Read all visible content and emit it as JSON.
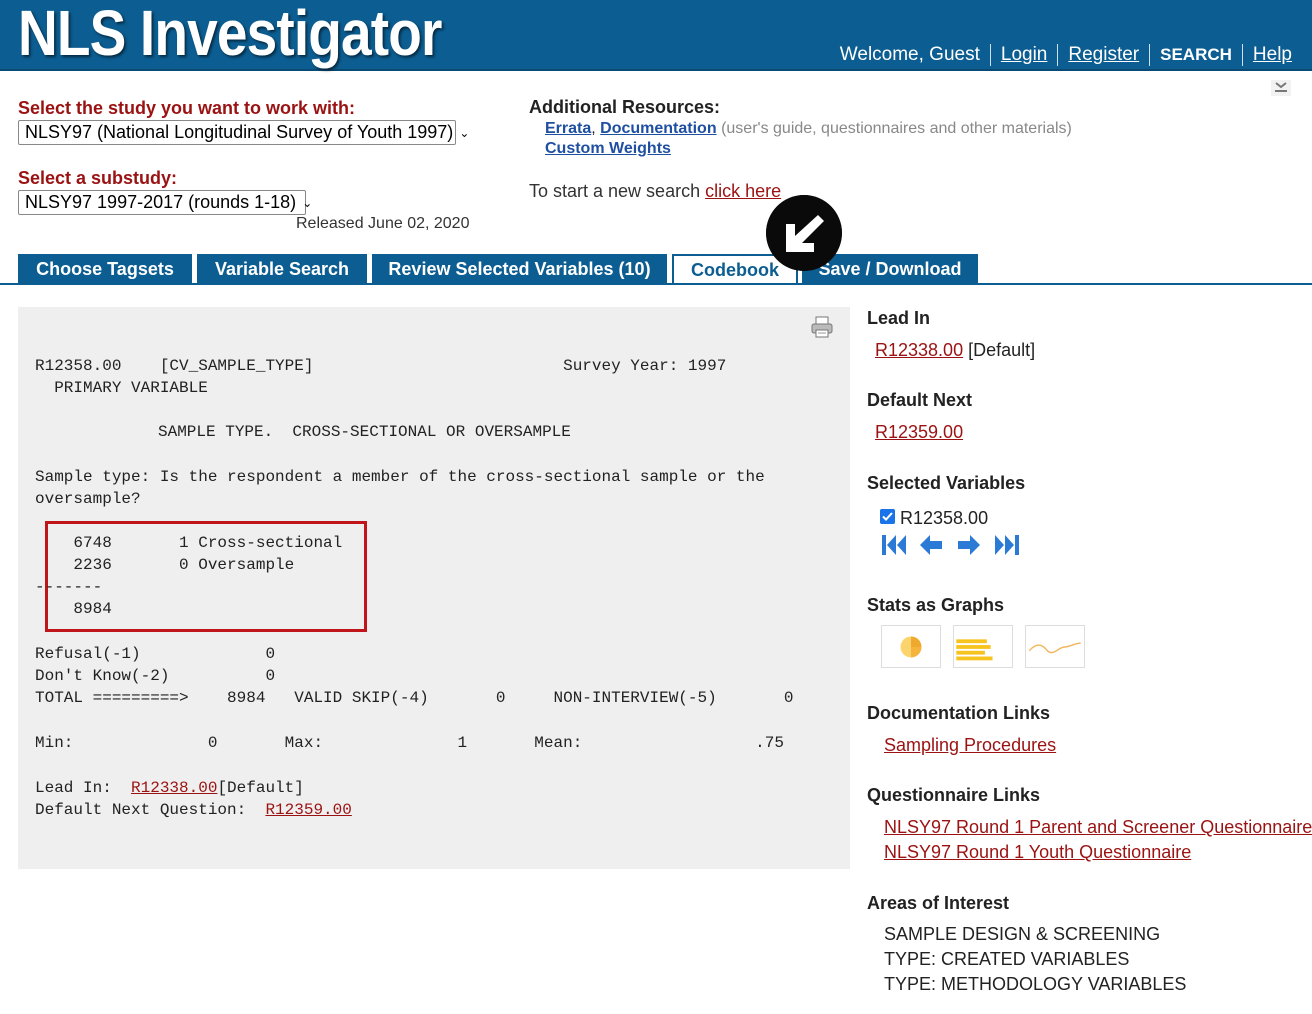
{
  "header": {
    "logo": "NLS Investigator",
    "welcome": "Welcome, Guest",
    "login": "Login",
    "register": "Register",
    "search": "SEARCH",
    "help": "Help"
  },
  "study": {
    "label": "Select the study you want to work with:",
    "selected": "NLSY97 (National Longitudinal Survey of Youth 1997)"
  },
  "substudy": {
    "label": "Select a substudy:",
    "selected": "NLSY97 1997-2017 (rounds 1-18)",
    "released": "Released June 02, 2020"
  },
  "resources": {
    "title": "Additional Resources:",
    "errata": "Errata",
    "comma": ",",
    "documentation": "Documentation",
    "doc_note": "(user's guide, questionnaires and other materials)",
    "custom_weights": "Custom Weights"
  },
  "new_search": {
    "text": "To start a new search",
    "link": "click here"
  },
  "tabs": [
    {
      "label": "Choose Tagsets"
    },
    {
      "label": "Variable Search"
    },
    {
      "label": "Review Selected Variables (10)"
    },
    {
      "label": "Codebook"
    },
    {
      "label": "Save / Download"
    }
  ],
  "codebook": {
    "line1": "R12358.00    [CV_SAMPLE_TYPE]                          Survey Year: 1997",
    "line2": "  PRIMARY VARIABLE",
    "line3": "SAMPLE TYPE.  CROSS-SECTIONAL OR OVERSAMPLE",
    "line4": "Sample type: Is the respondent a member of the cross-sectional sample or the",
    "line5": "oversample?",
    "freq1": "    6748       1 Cross-sectional",
    "freq2": "    2236       0 Oversample",
    "freq_sep": "-------",
    "freq_total": "    8984",
    "refusal": "Refusal(-1)             0",
    "dontknow": "Don't Know(-2)          0",
    "total_line": "TOTAL =========>    8984   VALID SKIP(-4)       0     NON-INTERVIEW(-5)       0",
    "stats_line": "Min:              0       Max:              1       Mean:                  .75",
    "lead_in_label": "Lead In:  ",
    "lead_in_link": "R12338.00",
    "lead_in_suffix": "[Default]",
    "default_next_label": "Default Next Question:  ",
    "default_next_link": "R12359.00"
  },
  "sidebar": {
    "lead_in_title": "Lead In",
    "lead_in_link": "R12338.00",
    "lead_in_suffix": "[Default]",
    "default_next_title": "Default Next",
    "default_next_link": "R12359.00",
    "selected_vars_title": "Selected Variables",
    "selected_var": "R12358.00",
    "stats_title": "Stats as Graphs",
    "doc_links_title": "Documentation Links",
    "doc_link": "Sampling Procedures",
    "q_links_title": "Questionnaire Links",
    "q_link1": "NLSY97 Round 1 Parent and Screener Questionnaires",
    "q_link2": "NLSY97 Round 1 Youth Questionnaire",
    "areas_title": "Areas of Interest",
    "areas": [
      "SAMPLE DESIGN & SCREENING",
      "TYPE: CREATED VARIABLES",
      "TYPE: METHODOLOGY VARIABLES"
    ]
  },
  "colors": {
    "header_blue": "#0c5d91",
    "link_red": "#9b1212",
    "link_blue": "#1f4fa0",
    "highlight_box": "#c0151a",
    "panel_bg": "#efefef"
  },
  "icons": [
    "collapse-icon",
    "print-icon",
    "arrow-badge-icon",
    "first-icon",
    "prev-icon",
    "next-icon",
    "last-icon",
    "pie-chart-icon",
    "bar-chart-icon",
    "line-chart-icon"
  ]
}
